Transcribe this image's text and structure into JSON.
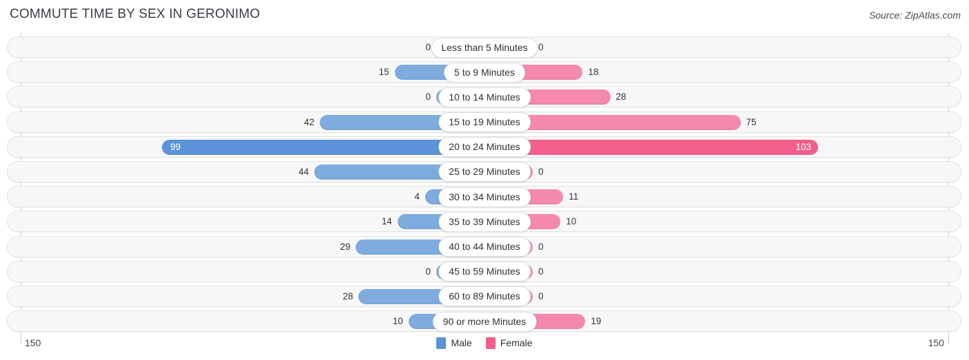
{
  "header": {
    "title": "COMMUTE TIME BY SEX IN GERONIMO",
    "source": "Source: ZipAtlas.com"
  },
  "legend": {
    "items": [
      {
        "label": "Male",
        "color": "#5b92d8"
      },
      {
        "label": "Female",
        "color": "#f25f8a"
      }
    ]
  },
  "axis": {
    "left_label": "150",
    "right_label": "150"
  },
  "chart_data": {
    "type": "bar",
    "subtype": "diverging-bar",
    "title": "COMMUTE TIME BY SEX IN GERONIMO",
    "xlabel": "",
    "ylabel": "",
    "axis_max": 150,
    "grid": false,
    "legend_position": "bottom-center",
    "categories": [
      "Less than 5 Minutes",
      "5 to 9 Minutes",
      "10 to 14 Minutes",
      "15 to 19 Minutes",
      "20 to 24 Minutes",
      "25 to 29 Minutes",
      "30 to 34 Minutes",
      "35 to 39 Minutes",
      "40 to 44 Minutes",
      "45 to 59 Minutes",
      "60 to 89 Minutes",
      "90 or more Minutes"
    ],
    "series": [
      {
        "name": "Male",
        "direction": "left",
        "color": "#7eacdf",
        "highlight_color": "#5b92d8",
        "values": [
          0,
          15,
          0,
          42,
          99,
          44,
          4,
          14,
          29,
          0,
          28,
          10
        ]
      },
      {
        "name": "Female",
        "direction": "right",
        "color": "#f589ac",
        "highlight_color": "#f25f8a",
        "values": [
          0,
          18,
          28,
          75,
          103,
          0,
          11,
          10,
          0,
          0,
          0,
          19
        ]
      }
    ],
    "highlight_row_index": 4
  }
}
